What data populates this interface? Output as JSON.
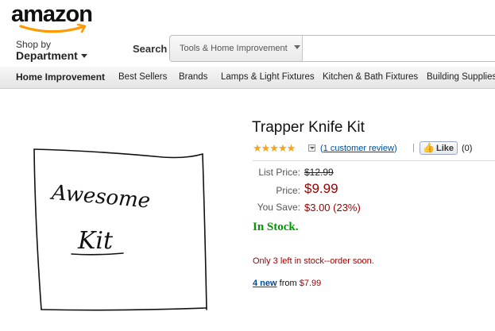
{
  "header": {
    "logo_text": "amazon",
    "shop_by": "Shop by",
    "department": "Department",
    "search_label": "Search",
    "search_category": "Tools & Home Improvement",
    "search_value": ""
  },
  "nav": {
    "items": [
      "Home Improvement",
      "Best Sellers",
      "Brands",
      "Lamps & Light Fixtures",
      "Kitchen & Bath Fixtures",
      "Building Supplies"
    ]
  },
  "product": {
    "image_text_line1": "Awesome",
    "image_text_line2": "Kit",
    "title": "Trapper Knife Kit",
    "stars": "★★★★★",
    "rating": 5,
    "review_text": "1 customer review",
    "like_label": "Like",
    "like_count": "(0)",
    "list_price_label": "List Price:",
    "list_price": "$12.99",
    "price_label": "Price:",
    "price": "$9.99",
    "save_label": "You Save:",
    "save_value": "$3.00 (23%)",
    "availability": "In Stock.",
    "low_stock_note": "Only 3 left in stock--order soon.",
    "offers_link": "4 new",
    "offers_from": "from",
    "offers_price": "$7.99"
  },
  "colors": {
    "price_red": "#990000",
    "in_stock_green": "#009900",
    "link_blue": "#004b91",
    "star_orange": "#f4a41d",
    "smile_orange": "#f90"
  }
}
